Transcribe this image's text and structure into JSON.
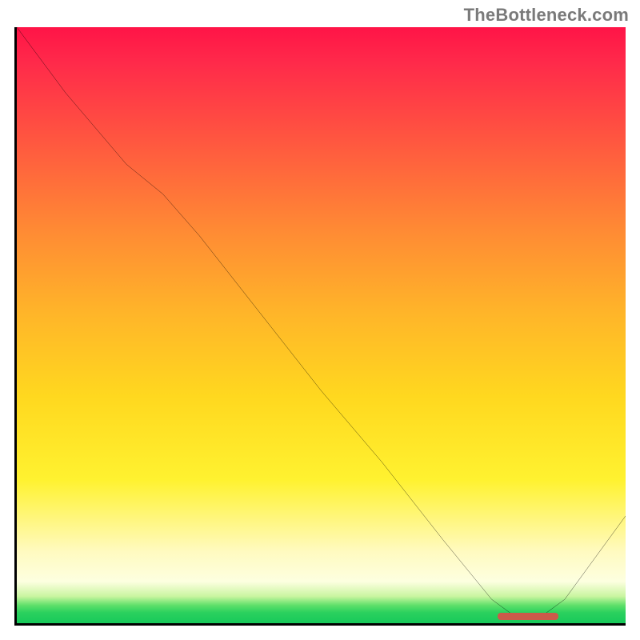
{
  "watermark": "TheBottleneck.com",
  "chart_data": {
    "type": "line",
    "title": "",
    "xlabel": "",
    "ylabel": "",
    "xlim": [
      0,
      100
    ],
    "ylim": [
      0,
      100
    ],
    "grid": false,
    "legend": false,
    "annotations": [],
    "series": [
      {
        "name": "bottleneck-curve",
        "x": [
          0,
          8,
          18,
          24,
          30,
          40,
          50,
          60,
          70,
          78,
          82,
          86,
          90,
          95,
          100
        ],
        "values": [
          100,
          89,
          77,
          72,
          65,
          52,
          39,
          27,
          14,
          4,
          1,
          1,
          4,
          11,
          18
        ]
      }
    ],
    "optimal_marker": {
      "x_start": 79,
      "x_end": 89,
      "y": 0.5
    },
    "background_gradient": {
      "stops": [
        {
          "pos": 0.0,
          "color": "#ff1447"
        },
        {
          "pos": 0.34,
          "color": "#ff8a34"
        },
        {
          "pos": 0.62,
          "color": "#ffd81f"
        },
        {
          "pos": 0.88,
          "color": "#fffac0"
        },
        {
          "pos": 0.97,
          "color": "#5fe06a"
        },
        {
          "pos": 1.0,
          "color": "#17c95a"
        }
      ]
    }
  }
}
